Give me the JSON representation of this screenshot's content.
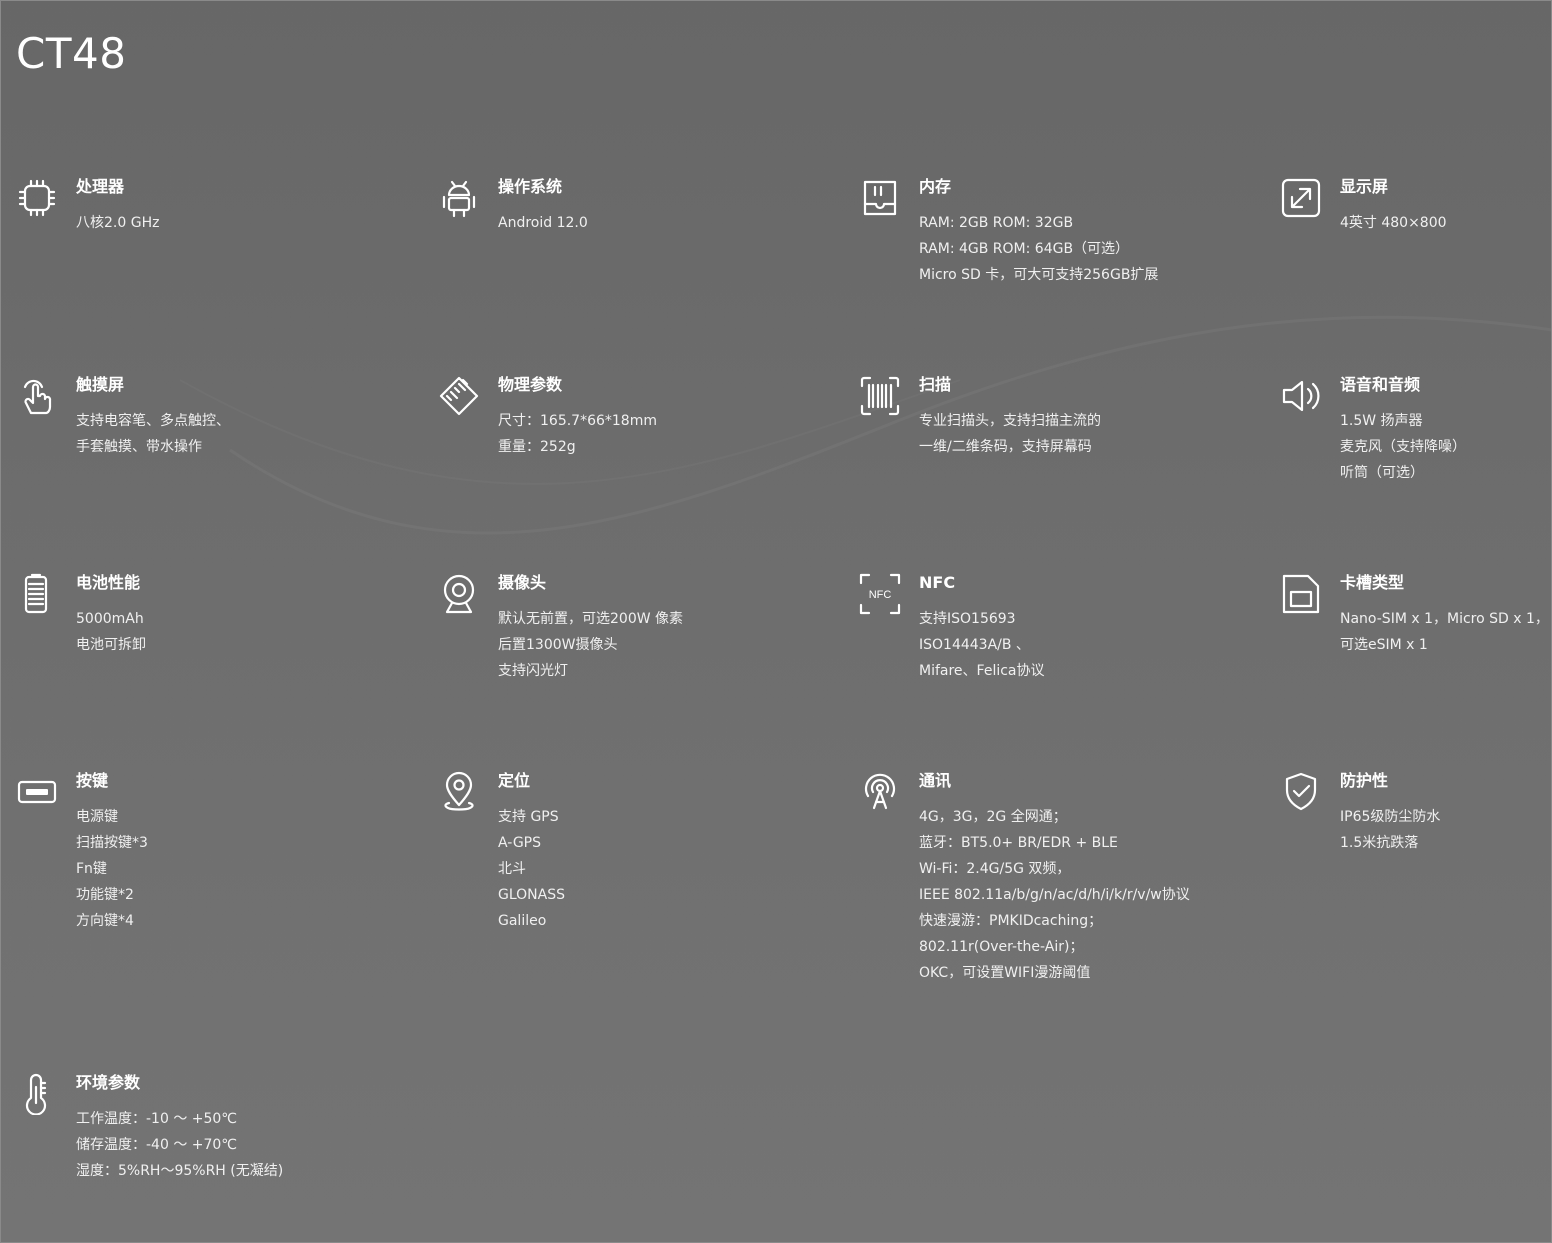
{
  "title": "CT48",
  "specs": {
    "cpu": {
      "icon": "cpu-icon",
      "label": "处理器",
      "lines": [
        "八核2.0 GHz"
      ]
    },
    "os": {
      "icon": "android-icon",
      "label": "操作系统",
      "lines": [
        "Android 12.0"
      ]
    },
    "memory": {
      "icon": "memory-icon",
      "label": "内存",
      "lines": [
        "RAM: 2GB ROM: 32GB",
        "RAM: 4GB ROM: 64GB（可选）",
        "Micro SD 卡，可大可支持256GB扩展"
      ]
    },
    "display": {
      "icon": "expand-icon",
      "label": "显示屏",
      "lines": [
        "4英寸 480×800"
      ]
    },
    "touch": {
      "icon": "touch-icon",
      "label": "触摸屏",
      "lines": [
        "支持电容笔、多点触控、",
        "手套触摸、带水操作"
      ]
    },
    "physical": {
      "icon": "ruler-icon",
      "label": "物理参数",
      "lines": [
        "尺寸：165.7*66*18mm",
        "重量：252g"
      ]
    },
    "scan": {
      "icon": "barcode-icon",
      "label": "扫描",
      "lines": [
        "专业扫描头，支持扫描主流的",
        "一维/二维条码，支持屏幕码"
      ]
    },
    "audio": {
      "icon": "speaker-icon",
      "label": "语音和音频",
      "lines": [
        "1.5W 扬声器",
        "麦克风（支持降噪）",
        "听筒（可选）"
      ]
    },
    "battery": {
      "icon": "battery-icon",
      "label": "电池性能",
      "lines": [
        "5000mAh",
        "电池可拆卸"
      ]
    },
    "camera": {
      "icon": "webcam-icon",
      "label": "摄像头",
      "lines": [
        "默认无前置，可选200W 像素",
        "后置1300W摄像头",
        "支持闪光灯"
      ]
    },
    "nfc": {
      "icon": "nfc-icon",
      "nfc_badge": "NFC",
      "label": "NFC",
      "lines": [
        "支持ISO15693",
        "ISO14443A/B 、",
        "Mifare、Felica协议"
      ]
    },
    "slot": {
      "icon": "sim-card-icon",
      "label": "卡槽类型",
      "lines": [
        "Nano-SIM x 1，Micro SD x 1，",
        "可选eSIM x 1"
      ]
    },
    "keys": {
      "icon": "key-button-icon",
      "label": "按键",
      "lines": [
        "电源键",
        "扫描按键*3",
        "Fn键",
        "功能键*2",
        "方向键*4"
      ]
    },
    "location": {
      "icon": "location-pin-icon",
      "label": "定位",
      "lines": [
        "支持 GPS",
        "A-GPS",
        "北斗",
        "GLONASS",
        "Galileo"
      ]
    },
    "comm": {
      "icon": "antenna-icon",
      "label": "通讯",
      "lines": [
        "4G，3G，2G 全网通；",
        "蓝牙：BT5.0+ BR/EDR + BLE",
        "Wi-Fi：2.4G/5G 双频，",
        "IEEE 802.11a/b/g/n/ac/d/h/i/k/r/v/w协议",
        "快速漫游：PMKIDcaching；",
        "802.11r(Over-the-Air)；",
        "OKC，可设置WIFI漫游阈值"
      ]
    },
    "protection": {
      "icon": "shield-check-icon",
      "label": "防护性",
      "lines": [
        "IP65级防尘防水",
        "1.5米抗跌落"
      ]
    },
    "env": {
      "icon": "thermometer-icon",
      "label": "环境参数",
      "lines": [
        "工作温度：-10 ～ +50℃",
        "储存温度：-40 ～ +70℃",
        "湿度：5%RH～95%RH (无凝结)"
      ]
    }
  }
}
